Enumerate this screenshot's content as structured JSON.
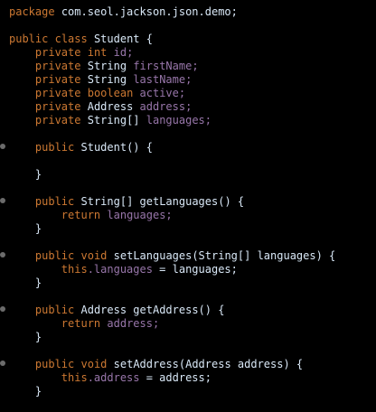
{
  "code": {
    "package_kw": "package",
    "package_name": "com.seol.jackson.json.demo;",
    "class_decl": {
      "public": "public",
      "class": "class",
      "name": "Student {"
    },
    "fields": [
      {
        "mod": "private",
        "type": "int",
        "name": "id;"
      },
      {
        "mod": "private",
        "type": "String",
        "name": "firstName;"
      },
      {
        "mod": "private",
        "type": "String",
        "name": "lastName;"
      },
      {
        "mod": "private",
        "type": "boolean",
        "name": "active;"
      },
      {
        "mod": "private",
        "type": "Address",
        "name": "address;"
      },
      {
        "mod": "private",
        "type": "String[]",
        "name": "languages;"
      }
    ],
    "ctor": {
      "mod": "public",
      "sig": "Student() {",
      "close": "}"
    },
    "getLanguages": {
      "mod": "public",
      "sig": "String[] getLanguages() {",
      "ret": "return",
      "val": "languages;",
      "close": "}"
    },
    "setLanguages": {
      "mod": "public",
      "void": "void",
      "sig": "setLanguages(String[] languages) {",
      "this": "this",
      "assign_field": ".languages",
      "assign_rest": " = languages;",
      "close": "}"
    },
    "getAddress": {
      "mod": "public",
      "sig": "Address getAddress() {",
      "ret": "return",
      "val": "address;",
      "close": "}"
    },
    "setAddress": {
      "mod": "public",
      "void": "void",
      "sig": "setAddress(Address address) {",
      "this": "this",
      "assign_field": ".address",
      "assign_rest": " = address;",
      "close": "}"
    }
  }
}
